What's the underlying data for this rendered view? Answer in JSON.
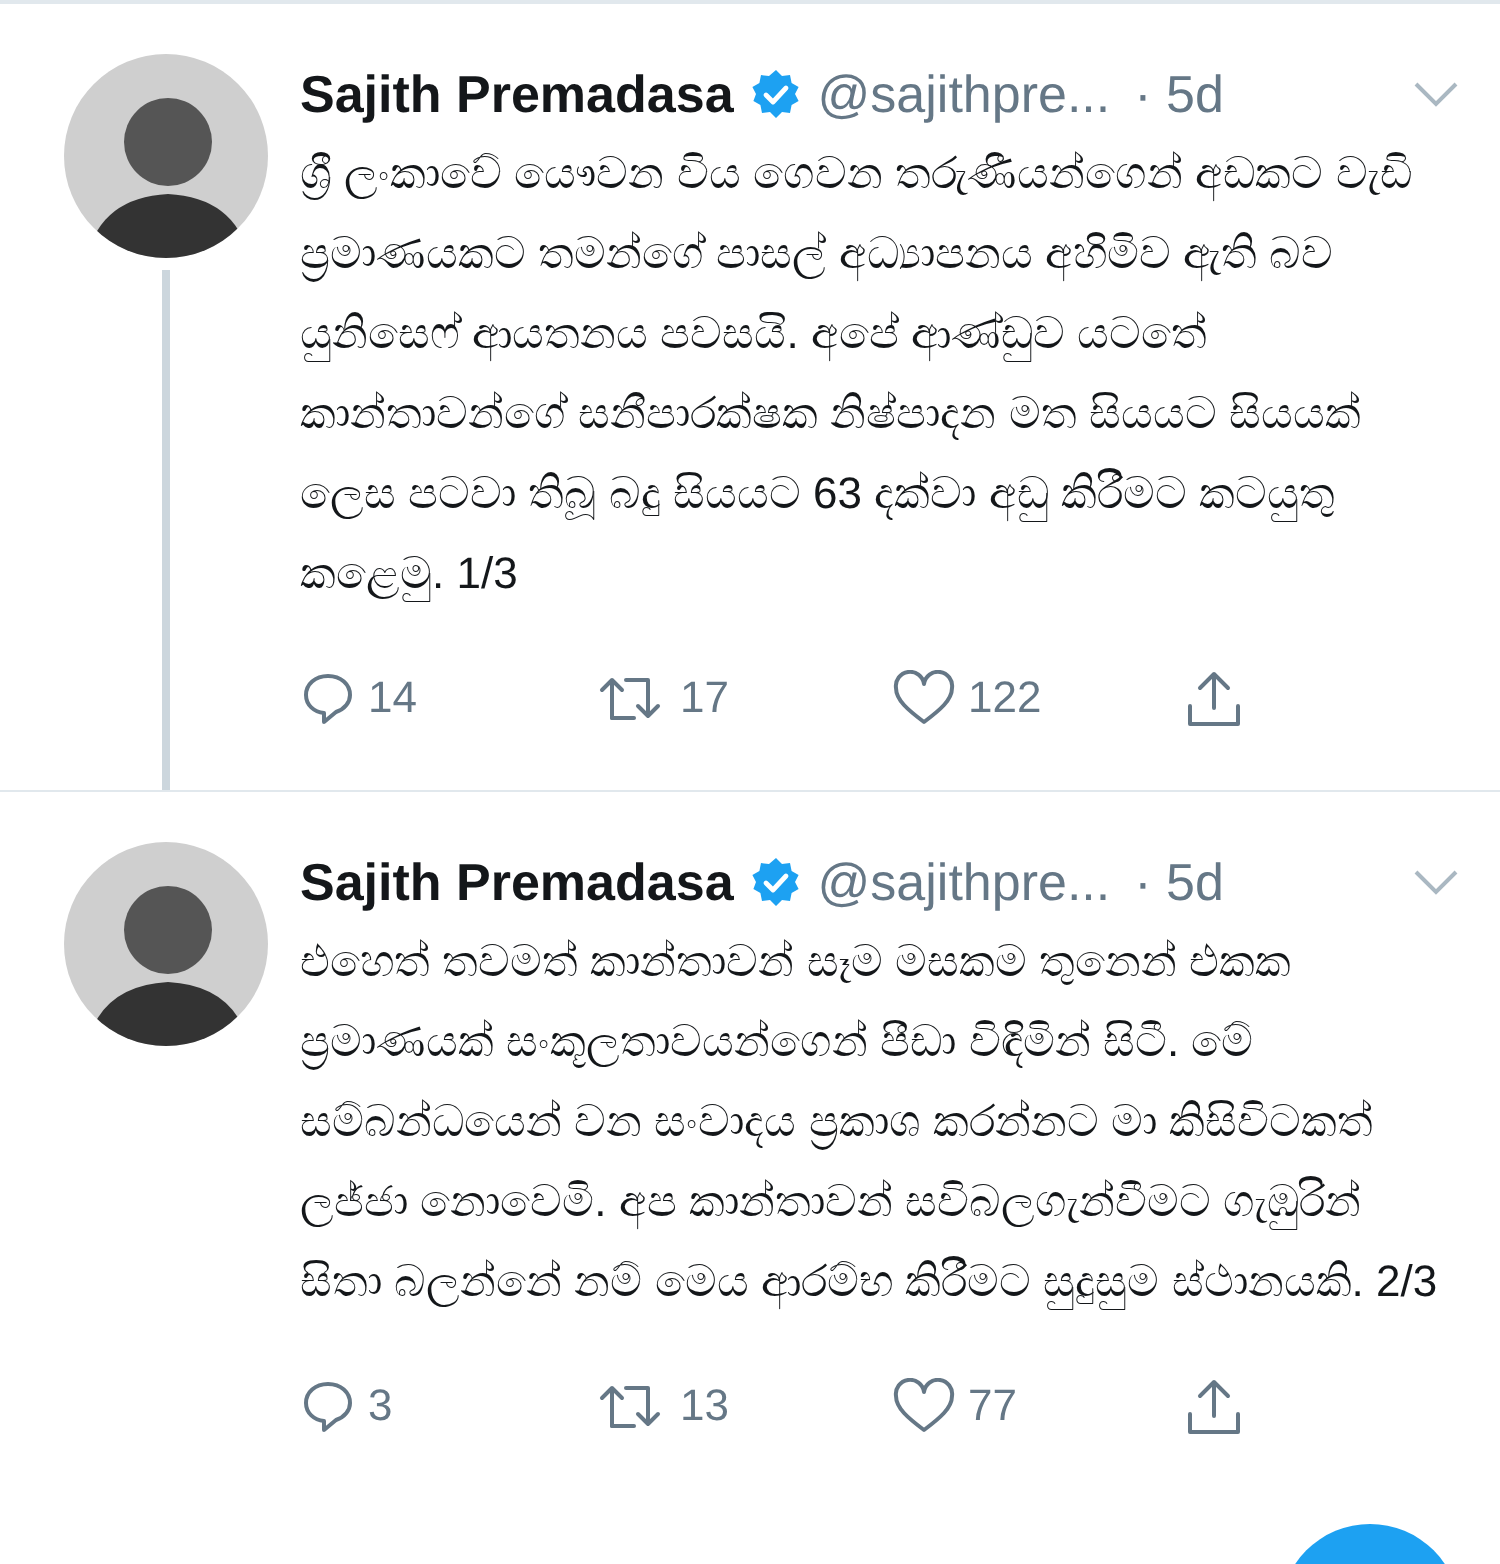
{
  "tweets": [
    {
      "name": "Sajith Premadasa",
      "verified": true,
      "handle": "@sajithpre...",
      "time": "· 5d",
      "thread_line": true,
      "text": "ශ්‍රී ලංකාවේ යෞවන විය ගෙවන තරුණීයන්ගෙන් අඩකට වැඩි ප්‍රමාණයකට තමන්ගේ පාසල් අධ්‍යාපනය අහිමිව ඇති බව යුනිසෙෆ් ආයතනය පවසයි. අපේ ආණ්ඩුව යටතේ කාන්තාවන්ගේ සනීපාරක්ෂක නිෂ්පාදන මත සියයට සියයක් ලෙස පටවා තිබූ බදු සියයට 63 දක්වා අඩු කිරීමට කටයුතු කළෙමු. 1/3",
      "replies": "14",
      "retweets": "17",
      "likes": "122"
    },
    {
      "name": "Sajith Premadasa",
      "verified": true,
      "handle": "@sajithpre...",
      "time": "· 5d",
      "thread_line": false,
      "text": "එහෙත් තවමත් කාන්තාවන්  සෑම මසකම තුනෙන් එකක ප්‍රමාණයක්  සංකූලතාවයන්ගෙන් පීඩා විඳිමින් සිටී. මේ සම්බන්ධයෙන් වන සංවාදය ප්‍රකාශ කරන්නට මා කිසිවිටකත් ලජ්ජා නොවෙමි. අප කාන්තාවන් සවිබලගැන්වීමට ගැඹුරින් සිතා බලන්නේ නම් මෙය ආරම්භ කිරීමට සුදුසුම ස්ථානයකි. 2/3",
      "replies": "3",
      "retweets": "13",
      "likes": "77"
    }
  ]
}
